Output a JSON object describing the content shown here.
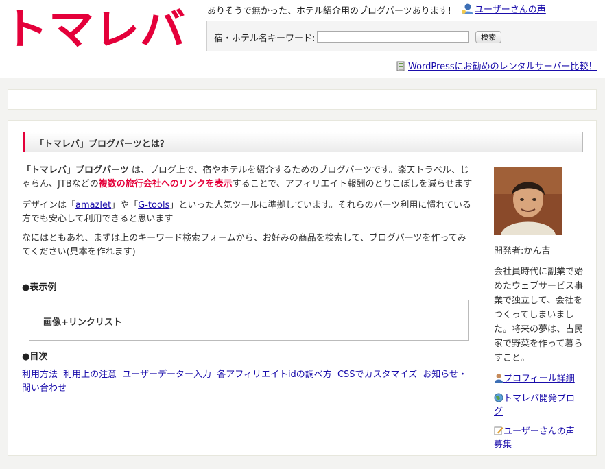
{
  "header": {
    "logo_text": "トマレバ",
    "tagline": "ありそうで無かった、ホテル紹介用のブログパーツあります!",
    "voice_link": "ユーザーさんの声",
    "search": {
      "label": "宿・ホテル名キーワード:",
      "value": "",
      "placeholder": "",
      "button": "検索"
    },
    "wp_link": "WordPressにお勧めのレンタルサーバー比較！"
  },
  "main": {
    "section_title": "「トマレバ」ブログパーツとは？",
    "para1": {
      "bold": "「トマレバ」ブログパーツ",
      "t1": " は、ブログ上で、宿やホテルを紹介するためのブログパーツです。楽天トラベル、じゃらん、JTBなどの",
      "red": "複数の旅行会社へのリンクを表示",
      "t2": "することで、アフィリエイト報酬のとりこぼしを減らせます"
    },
    "para2": {
      "t1": "デザインは「",
      "link1": "amazlet",
      "t2": "」や「",
      "link2": "G-tools",
      "t3": "」といった人気ツールに準拠しています。それらのパーツ利用に慣れている方でも安心して利用できると思います"
    },
    "para3": "なにはともあれ、まずは上のキーワード検索フォームから、お好みの商品を検索して、ブログパーツを作ってみてください(見本を作れます)",
    "sample_heading": "●表示例",
    "sample_content": "画像+リンクリスト",
    "toc_heading": "●目次",
    "toc_links": [
      "利用方法",
      "利用上の注意",
      "ユーザーデーター入力",
      "各アフィリエイトidの調べ方",
      "CSSでカスタマイズ",
      "お知らせ・問い合わせ"
    ]
  },
  "sidebar": {
    "developer": "開発者:かん吉",
    "bio": "会社員時代に副業で始めたウェブサービス事業で独立して、会社をつくってしまいました。将来の夢は、古民家で野菜を作って暮らすこと。",
    "links": [
      "プロフィール詳細",
      "トマレバ開発ブログ",
      "ユーザーさんの声募集"
    ]
  },
  "colors": {
    "brand_red": "#e4003a",
    "link": "#1a0dab"
  }
}
